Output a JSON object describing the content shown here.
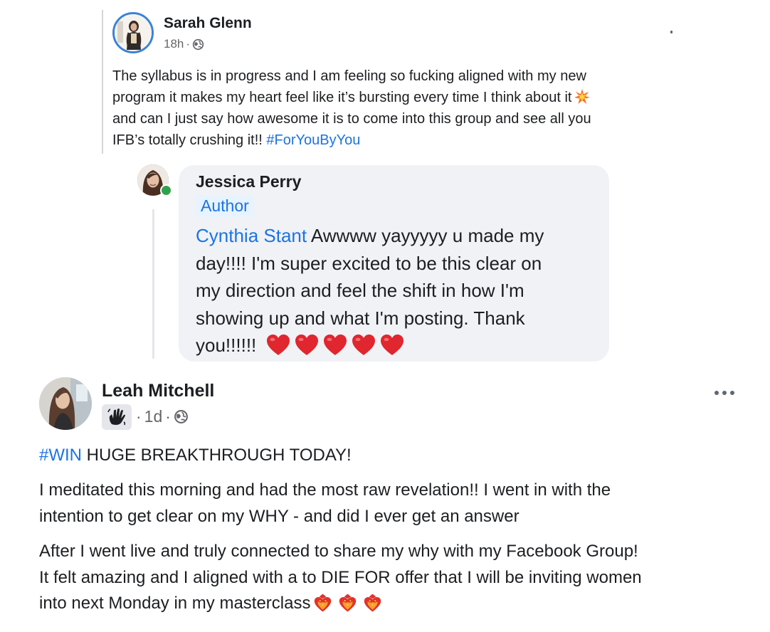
{
  "post1": {
    "author": "Sarah Glenn",
    "time": "18h",
    "meta_sep": "·",
    "audience_icon": "globe-icon",
    "lines": [
      "The syllabus is in progress and I am feeling so fucking aligned with my new",
      "program it makes my heart feel like it’s bursting every time I think about it",
      "and can I just say how awesome it is to come into this group and see all you",
      "IFB’s totally crushing it!!"
    ],
    "hashtag": "#ForYouByYou",
    "emoji": "sparkle-burst-icon"
  },
  "comment": {
    "author": "Jessica Perry",
    "badge": "Author",
    "mention": "Cynthia Stant",
    "lines": [
      "Awwww yayyyyy u made my",
      "day!!!!  I'm super excited to be this clear on",
      "my direction and feel the shift in how I'm",
      "showing up and what I'm posting. Thank",
      "you!!!!!!"
    ],
    "hearts_count": 5,
    "heart_color": "#e0262f"
  },
  "post2": {
    "author": "Leah Mitchell",
    "badge_icon": "waving-hand-icon",
    "time": "1d",
    "meta_sep": "·",
    "audience_icon": "globe-icon",
    "hashtag": "#WIN",
    "headline": " HUGE BREAKTHROUGH TODAY!",
    "paragraph1": [
      "I meditated this morning and had the most raw revelation!! I went in with the",
      "intention to get clear on my WHY - and did I ever get an answer"
    ],
    "paragraph2": [
      "After I went live and truly connected to share my why with my Facebook Group!",
      "It felt amazing and I aligned with a to DIE FOR offer that I will be inviting women",
      "into next Monday in my masterclass"
    ],
    "trailing_emoji": "strawberry-heart-icon",
    "trailing_emoji_count": 3
  },
  "colors": {
    "link": "#1b74e4",
    "text": "#1c1e21",
    "secondary": "#65676b",
    "bubble": "#f0f2f5",
    "online": "#31a24c"
  }
}
